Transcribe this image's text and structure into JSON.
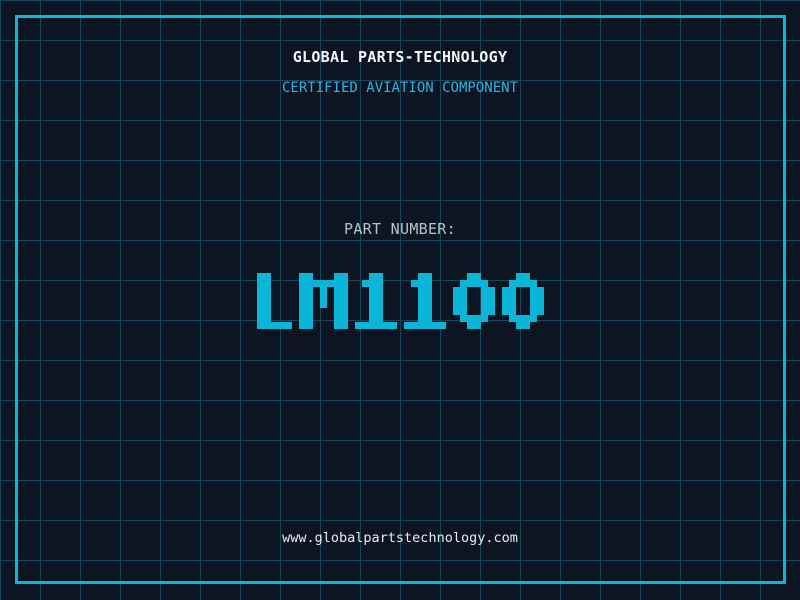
{
  "header": {
    "title": "GLOBAL PARTS-TECHNOLOGY",
    "subtitle": "CERTIFIED AVIATION COMPONENT"
  },
  "part_number": {
    "label": "PART NUMBER:",
    "value": "LM1100"
  },
  "footer": {
    "website": "www.globalpartstechnology.com"
  },
  "colors": {
    "background": "#0e1522",
    "grid_line": "#18455a",
    "frame_cyan": "#10b4d9",
    "part_value_cyan": "#0bb5d8",
    "subtitle_cyan": "#2eb4de",
    "title_white": "#f4f6f8",
    "label_gray": "#b9c2cb",
    "url_light": "#e9ecee"
  }
}
